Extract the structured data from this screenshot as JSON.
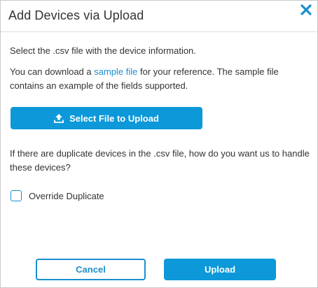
{
  "dialog": {
    "title": "Add Devices via Upload",
    "close_icon": "close-x-icon"
  },
  "body": {
    "instruction": "Select the .csv file with the device information.",
    "download_prefix": "You can download a ",
    "sample_link": "sample file",
    "download_suffix": " for your reference. The sample file contains an example of the fields supported.",
    "select_button_label": "Select File to Upload",
    "select_button_icon": "upload-icon",
    "duplicates_question": "If there are duplicate devices in the .csv file, how do you want us to handle these devices?",
    "override_label": "Override Duplicate",
    "override_checked": false
  },
  "footer": {
    "cancel_label": "Cancel",
    "upload_label": "Upload"
  },
  "colors": {
    "accent": "#0c98d9",
    "link": "#1a8fcf",
    "text": "#333333"
  }
}
